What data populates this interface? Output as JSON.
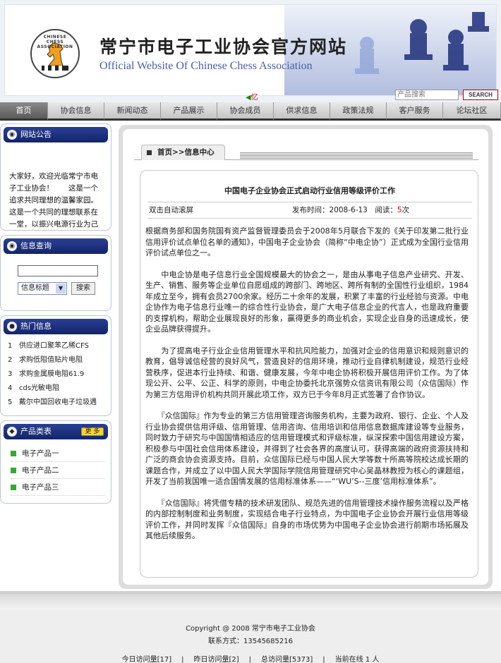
{
  "header": {
    "title": "常宁市电子工业协会官方网站",
    "subtitle": "Official Website Of Chinese Chess Association",
    "logo_text": "CHINESE CHESS ASSOCIATION",
    "speaker_label": "忆",
    "search_placeholder": "产品搜索",
    "search_button": "SEARCH"
  },
  "nav": [
    "首页",
    "协会信息",
    "新闻动态",
    "产品展示",
    "协会成员",
    "供求信息",
    "政策法规",
    "客户服务",
    "论坛社区"
  ],
  "sidebar": {
    "notice_title": "网站公告",
    "notice_text": "大家好，欢迎光临常宁市电子工业协会！　　这是一个追求共同理想的温馨家园。这是一个共同的理想联系在一堂，以振兴电源行业为己任，与振兴电源行业为己任，加紧前进。",
    "search_title": "信息查询",
    "search_select": "信息标题",
    "search_button": "搜索",
    "hot_title": "热门信息",
    "hot_items": [
      {
        "num": "1",
        "text": "供应进口聚苯乙稀CFS"
      },
      {
        "num": "2",
        "text": "求购低阻值贴片电阻"
      },
      {
        "num": "3",
        "text": "求购金属膜电阻61.9"
      },
      {
        "num": "4",
        "text": "cds光敏电阻"
      },
      {
        "num": "5",
        "text": "戴尔中国回收电子垃圾遇"
      }
    ],
    "cat_title": "产品类表",
    "cat_more": "更 多",
    "categories": [
      "电子产品一",
      "电子产品二",
      "电子产品三"
    ]
  },
  "main": {
    "breadcrumb": "首页>>信息中心",
    "title": "中国电子企业协会正式启动行业信用等级评价工作",
    "scroll_label": "双击自动滚屏",
    "date_label": "发布时间：2008-6-13",
    "views_label": "阅读：",
    "views_count": "5",
    "views_unit": "次",
    "paragraphs": [
      "根据商务部和国务院国有资产监督管理委员会于2008年5月联合下发的《关于印发第二批行业信用评价试点单位名单的通知》，中国电子企业协会（简称“中电企协”）正式成为全国行业信用评价试点单位之一。",
      "　　中电企协是电子信息行业全国规模最大的协会之一，是由从事电子信息产业研究、开发、生产、销售、服务等企业单位自愿组成的跨部门、跨地区、跨所有制的全国性行业组织，1984年成立至今，拥有会员2700余家。经历二十余年的发展，积累了丰富的行业经验与资源。中电企协作为电子信息行业唯一的综合性行业协会，是广大电子信息企业的代言人，也是政府重要的支撑机构，帮助企业展现良好的形象，赢得更多的商业机会，实现企业自身的迅速成长，使企业品牌获得提升。",
      "　　为了提高电子行业企业信用管理水平和抗风险能力，加强对企业的信用意识和规则意识的教育，倡导诚信经营的良好风气，营造良好的信用环境，推动行业自律机制建设，规范行业经营秩序，促进本行业持续、和谐、健康发展，今年中电企协将积极开展信用评价工作。为了体现公开、公平、公正、科学的原则，中电企协委托北京强势众信资讯有限公司（众信国际）作为第三方信用评价机构共同开展此项工作，双方已于今年8月正式签署了合作协议。",
      "　　『众信国际』作为专业的第三方信用管理咨询服务机构，主要为政府、银行、企业、个人及行业协会提供信用评级、信用管理、信用咨询、信用培训和信用信息数据库建设等专业服务，同时致力于研究与中国国情相适应的信用管理模式和评级标准，纵深探索中国信用建设方案，积极参与中国社会信用体系建设，并得到了社会各界的高度认可，获得高端的政府资源扶持和广泛的商会协会资源支持。目前，众信国际已经与中国人民大学等数十所高等院校达成长期的课题合作，并成立了以中国人民大学国际学院信用管理研究中心吴晶林教授为核心的课题组，开发了当前我国唯一适合国情发展的信用标准体系——“‘WU’S--三度’信用标准体系”。",
      "　　『众信国际』将凭借专精的技术研发团队、规范先进的信用管理技术操作服务流程以及严格的内部控制制度和业务制度，实现结合电子行业特点，为中国电子企业协会开展行业信用等级评价工作，并同时发挥『众信国际』自身的市场优势为中国电子企业协会进行前期市场拓展及其他后续服务。"
    ]
  },
  "footer": {
    "copyright": "Copyright @ 2008 常宁市电子工业协会",
    "contact": "联系方式：13545685216",
    "stats": [
      "今日访问量[17]",
      "昨日访问量[2]",
      "总访问量[5373]",
      "当前在线 1 人"
    ]
  }
}
